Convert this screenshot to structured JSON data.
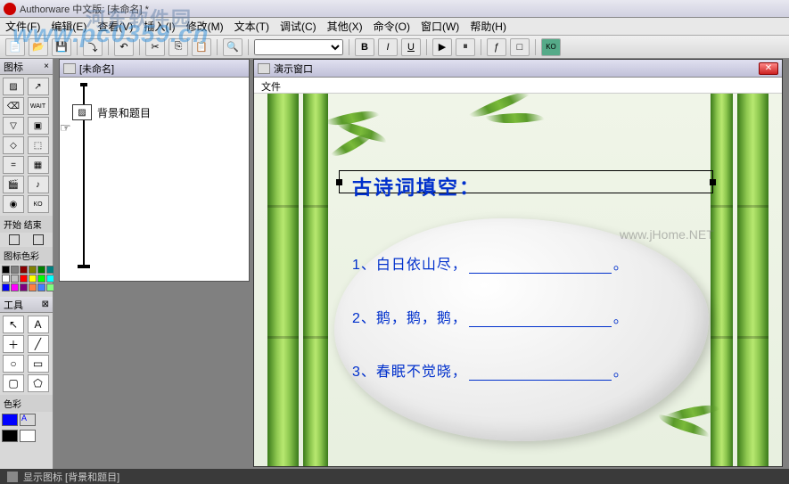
{
  "titlebar": {
    "text": "Authorware 中文版: [未命名] *"
  },
  "menubar": {
    "items": [
      "文件(F)",
      "编辑(E)",
      "查看(V)",
      "插入(I)",
      "修改(M)",
      "文本(T)",
      "调试(C)",
      "其他(X)",
      "命令(O)",
      "窗口(W)",
      "帮助(H)"
    ]
  },
  "toolbar": {
    "font_dropdown": "",
    "bold": "B",
    "italic": "I",
    "underline": "U"
  },
  "leftpanel": {
    "icons_title": "图标",
    "start_end": "开始 结束",
    "color_title": "图标色彩",
    "tools_title": "工具",
    "colorfill_title": "色彩"
  },
  "flowwin": {
    "title": "[未命名]",
    "item1": "背景和题目"
  },
  "presentwin": {
    "title": "演示窗口",
    "menu_file": "文件",
    "poem_title": "古诗词填空：",
    "line1_pre": "1、白日依山尽，",
    "line2_pre": "2、鹅，鹅，鹅，",
    "line3_pre": "3、春眠不觉晓，",
    "suffix": "。"
  },
  "statusbar": {
    "text": "显示图标 [背景和题目]"
  },
  "watermarks": {
    "w1": "www.pc0359.cn",
    "w2": "www.jHome.NET",
    "w3": "河东软件园"
  },
  "colors": {
    "palette": [
      "#000",
      "#808080",
      "#800",
      "#808000",
      "#008000",
      "#008080",
      "#fff",
      "#c0c0c0",
      "#f00",
      "#ff0",
      "#0f0",
      "#0ff",
      "#00f",
      "#f0f",
      "#800080",
      "#ff8040",
      "#4080ff",
      "#80ff80"
    ]
  }
}
